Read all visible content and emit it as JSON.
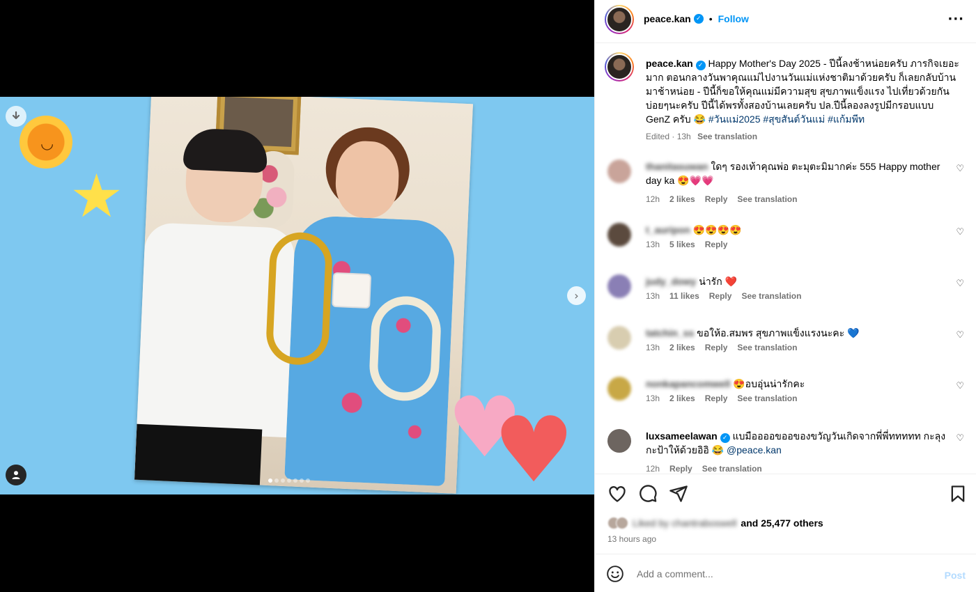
{
  "post": {
    "username": "peace.kan",
    "follow_label": "Follow",
    "more_icon": "more-options-icon",
    "media": {
      "carousel_total": 7,
      "carousel_active": 1
    },
    "caption": {
      "text": "Happy Mother's Day 2025 - ปีนี้ลงช้าหน่อยครับ ภารกิจเยอะมาก ตอนกลางวันพาคุณแม่ไปงานวันแม่แห่งชาติมาด้วยครับ ก็เลยกลับบ้านมาช้าหน่อย - ปีนี้ก็ขอให้คุณแม่มีความสุข สุขภาพแข็งแรง ไปเที่ยวด้วยกันบ่อยๆนะครับ ปีนี้ได้พรทั้งสองบ้านเลยครับ ปล.ปีนี้ลองลงรูปมีกรอบแบบ GenZ ครับ 😂",
      "hashtags": "#วันแม่2025 #สุขสันต์วันแม่ #แก้มพีท",
      "edited": "Edited · 13h",
      "see_translation": "See translation"
    }
  },
  "comments": [
    {
      "name": "thanitasuwan",
      "text": "ใดๆ รองเท้าคุณพ่อ ตะมุตะมิมากค่ะ 555 Happy mother day ka 😍💗💗",
      "time": "12h",
      "likes": "2 likes",
      "reply": "Reply",
      "translate": "See translation",
      "avatar_color": "#c9a49a"
    },
    {
      "name": "t_auripon",
      "text": "😍😍😍😍",
      "time": "13h",
      "likes": "5 likes",
      "reply": "Reply",
      "translate": "",
      "avatar_color": "#5b4a3e"
    },
    {
      "name": "judy_dowy",
      "text": "น่ารัก ❤️",
      "time": "13h",
      "likes": "11 likes",
      "reply": "Reply",
      "translate": "See translation",
      "avatar_color": "#8a7fb5"
    },
    {
      "name": "tatchin_ss",
      "text": "ขอให้อ.สมพร สุขภาพแข็งแรงนะคะ 💙",
      "time": "13h",
      "likes": "2 likes",
      "reply": "Reply",
      "translate": "See translation",
      "avatar_color": "#d8cdb0"
    },
    {
      "name": "nonkapancomwell",
      "text": "😍อบอุ่นน่ารักคะ",
      "time": "13h",
      "likes": "2 likes",
      "reply": "Reply",
      "translate": "See translation",
      "avatar_color": "#c8a846"
    },
    {
      "name": "luxsameelawan",
      "text": "แบมืออออขออของขวัญวันเกิดจากพี่พี่ททททท กะลุงกะป้าให้ด้วยอิอิ 😂",
      "mention": "@peace.kan",
      "time": "12h",
      "likes": "",
      "reply": "Reply",
      "translate": "See translation",
      "avatar_color": "#6d6560"
    }
  ],
  "actions": {
    "liked_by": "Liked by chantraboswell",
    "and_others": "and 25,477 others",
    "time_ago": "13 hours ago"
  },
  "add_comment": {
    "placeholder": "Add a comment...",
    "post_label": "Post"
  },
  "colors": {
    "accent": "#0095f6",
    "hashtag": "#00376b",
    "muted": "#737373",
    "post_disabled": "#b3dbff"
  }
}
